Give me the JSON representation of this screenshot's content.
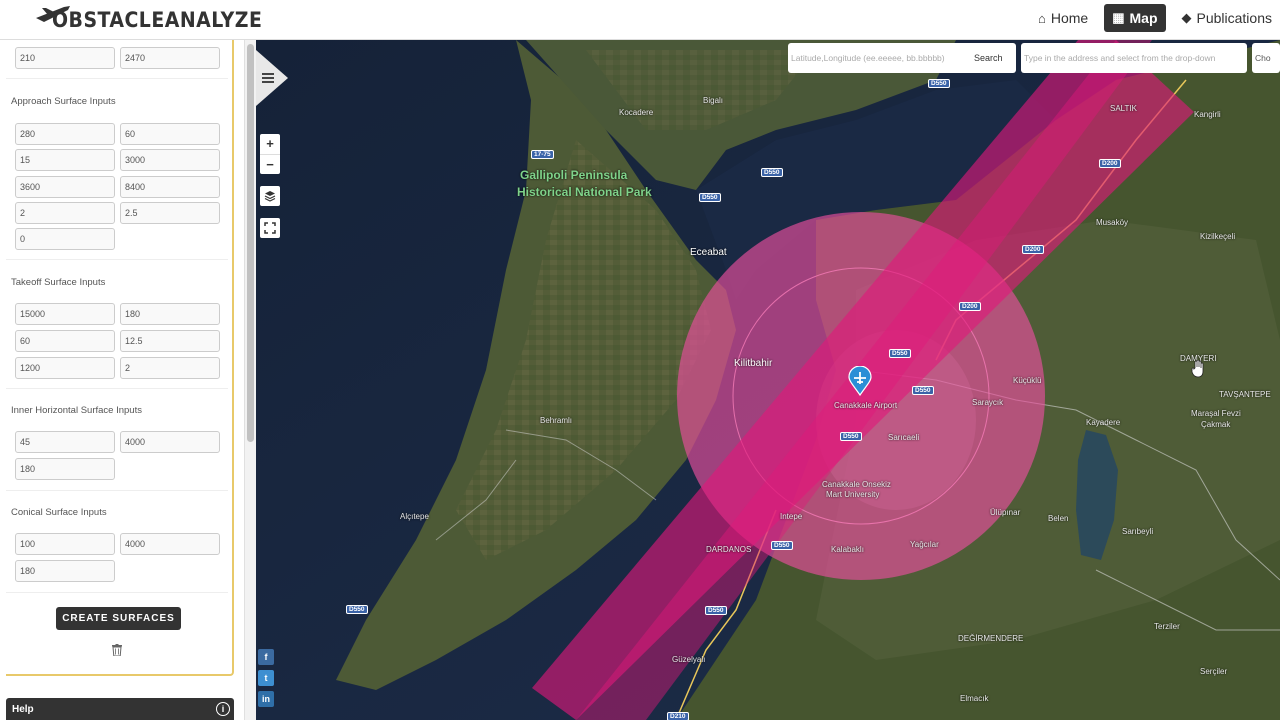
{
  "header": {
    "logo_text": "OBSTACLEANALYZE",
    "nav": [
      {
        "label": "Home",
        "icon": "home-icon",
        "active": false
      },
      {
        "label": "Map",
        "icon": "map-icon",
        "active": true
      },
      {
        "label": "Publications",
        "icon": "tag-icon",
        "active": false
      }
    ]
  },
  "sidebar": {
    "top_fields": [
      "210",
      "2470"
    ],
    "sections": [
      {
        "label": "Approach Surface Inputs",
        "fields": [
          "280",
          "60",
          "15",
          "3000",
          "3600",
          "8400",
          "2",
          "2.5",
          "0"
        ]
      },
      {
        "label": "Takeoff Surface Inputs",
        "fields": [
          "15000",
          "180",
          "60",
          "12.5",
          "1200",
          "2"
        ]
      },
      {
        "label": "Inner Horizontal Surface Inputs",
        "fields": [
          "45",
          "4000",
          "180"
        ]
      },
      {
        "label": "Conical Surface Inputs",
        "fields": [
          "100",
          "4000",
          "180"
        ]
      }
    ],
    "create_button": "CREATE SURFACES",
    "help_label": "Help",
    "help_icon": "info-icon"
  },
  "map": {
    "coord_search_placeholder": "Latitude,Longitude (ee.eeeee, bb.bbbbb)",
    "coord_search_button": "Search",
    "address_placeholder": "Type in the address and select from the drop-down",
    "choose_label": "Cho",
    "zoom_in": "+",
    "zoom_out": "−",
    "labels": {
      "peninsula": "Gallipoli Peninsula",
      "park": "Historical National Park",
      "eceabat": "Eceabat",
      "kilitbahir": "Kilitbahir",
      "behramli": "Behramlı",
      "alcitepe": "Alçıtepe",
      "airport": "Canakkale Airport",
      "university_1": "Canakkale Onsekiz",
      "university_2": "Mart University",
      "saricaeli": "Sarıcaeli",
      "kalabakli": "Kalabaklı",
      "yagcilar": "Yağcılar",
      "ulupinar": "Ülüpınar",
      "kocadere": "Kocadere",
      "bigali": "Bigalı",
      "saltik": "SALTIK",
      "kangirli": "Kangirli",
      "musakoy": "Musaköy",
      "kizilkececili": "Kizilkeçeli",
      "damyeri": "DAMYERI",
      "tavsantepe": "TAVŞANTEPE",
      "marasal_1": "Maraşal Fevzi",
      "marasal_2": "Çakmak",
      "kayadere": "Kayadere",
      "belen": "Belen",
      "saribeyli": "Sarıbeyli",
      "terziler": "Terziler",
      "degirmendere": "DEĞİRMENDERE",
      "serciler": "Serçiler",
      "elmacik": "Elmacık",
      "guzelyali": "Güzelyalı",
      "kucuklu": "Küçüklü",
      "sarapcik": "Saraycık",
      "dardanos": "DARDANOS",
      "intepe": "Intepe"
    },
    "road_badges": [
      "D550",
      "17-75",
      "D550",
      "D550",
      "D200",
      "D200",
      "D200",
      "D550",
      "D550",
      "D550",
      "D550",
      "D550",
      "D550",
      "D210"
    ],
    "colors": {
      "surface_fill": "#e0197a",
      "circle_fill": "#e94f9e",
      "water": "#1b2a45",
      "land": "#4b5a33"
    }
  }
}
